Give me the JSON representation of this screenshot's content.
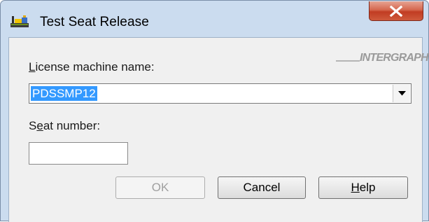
{
  "window": {
    "title": "Test Seat Release"
  },
  "logo": {
    "text": "INTERGRAPH"
  },
  "license": {
    "label_accel": "L",
    "label_rest": "icense machine name:",
    "selected_value": "PDSSMP12"
  },
  "seat": {
    "label_pre": "S",
    "label_accel": "e",
    "label_rest": "at number:",
    "value": ""
  },
  "buttons": {
    "ok": "OK",
    "cancel": "Cancel",
    "help_accel": "H",
    "help_rest": "elp"
  }
}
